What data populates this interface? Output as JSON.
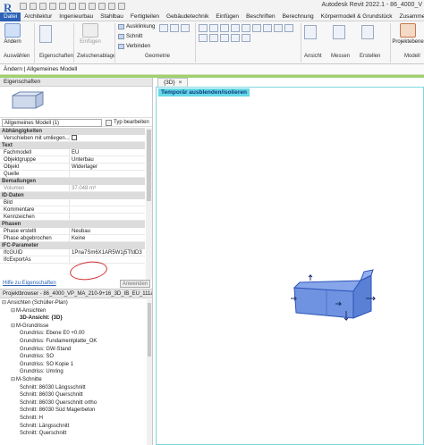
{
  "app": {
    "logo_letter": "R",
    "title": "Autodesk Revit 2022.1 - 86_4000_V"
  },
  "tabs": [
    {
      "label": "Datei",
      "active": true
    },
    {
      "label": "Architektur"
    },
    {
      "label": "Ingenieurbau"
    },
    {
      "label": "Stahlbau"
    },
    {
      "label": "Fertigteilen"
    },
    {
      "label": "Gebäudetechnik"
    },
    {
      "label": "Einfügen"
    },
    {
      "label": "Beschriften"
    },
    {
      "label": "Berechnung"
    },
    {
      "label": "Körpermodell & Grundstück"
    },
    {
      "label": "Zusammenarbe"
    }
  ],
  "ribbon": {
    "modify_label": "Ändern",
    "clipboard": {
      "paste": "Einfügen"
    },
    "geometry": {
      "cut_fill": "Ausklinkung",
      "cut": "Schnitt",
      "join": "Verbinden"
    },
    "groups": {
      "select": "Auswählen",
      "properties": "Eigenschaften",
      "clipboard": "Zwischenablage",
      "geometry": "Geometrie",
      "view": "Ansicht",
      "measure": "Messen",
      "create": "Erstellen",
      "model": "Modell"
    },
    "project_model": "Projektebene",
    "model_label": "Modell"
  },
  "context_bar": {
    "label": "Ändern | Allgemeines Modell"
  },
  "properties": {
    "header": "Eigenschaften",
    "instance_selector": "Allgemeines Modell (1)",
    "edit_type": "Typ bearbeiten",
    "sections": [
      {
        "name": "Abhängigkeiten",
        "rows": [
          {
            "key": "Verschieben mit umliegen...",
            "value": "",
            "checkbox": true
          }
        ]
      },
      {
        "name": "Text",
        "rows": [
          {
            "key": "Fachmodell",
            "value": "EU"
          },
          {
            "key": "Objektgruppe",
            "value": "Unterbau"
          },
          {
            "key": "Objekt",
            "value": "Widerlager"
          },
          {
            "key": "Quelle",
            "value": ""
          }
        ]
      },
      {
        "name": "Bemaßungen",
        "rows": [
          {
            "key": "Volumen",
            "value": "37.048 m³",
            "dim": true
          }
        ]
      },
      {
        "name": "ID-Daten",
        "rows": [
          {
            "key": "Bild",
            "value": ""
          },
          {
            "key": "Kommentare",
            "value": ""
          },
          {
            "key": "Kennzeichen",
            "value": ""
          }
        ]
      },
      {
        "name": "Phasen",
        "rows": [
          {
            "key": "Phase erstellt",
            "value": "Neubau"
          },
          {
            "key": "Phase abgebrochen",
            "value": "Keine"
          }
        ]
      },
      {
        "name": "IFC-Parameter",
        "rows": [
          {
            "key": "IfcGUID",
            "value": "1Pna7Sm6X1AR5W1j5TfdD3"
          },
          {
            "key": "IfcExportAs",
            "value": ""
          }
        ]
      }
    ],
    "help_link": "Hilfe zu Eigenschaften",
    "apply": "Anwenden"
  },
  "browser": {
    "header": "Projektbrowser - 86_4000_VP_MA_210-9+16_3D_IB_EU_111a...",
    "items": [
      {
        "label": "Ansichten (Schüller-Plan)",
        "level": 0,
        "toggle": "⊟"
      },
      {
        "label": "M-Ansichten",
        "level": 1,
        "toggle": "⊟"
      },
      {
        "label": "3D-Ansicht: {3D}",
        "level": 2,
        "selected": true
      },
      {
        "label": "M-Grundrisse",
        "level": 1,
        "toggle": "⊟"
      },
      {
        "label": "Grundriss: Ebene E0 +0.00",
        "level": 2
      },
      {
        "label": "Grundriss: Fundamentplatte_OK",
        "level": 2
      },
      {
        "label": "Grundriss: GW-Stand",
        "level": 2
      },
      {
        "label": "Grundriss: SO",
        "level": 2
      },
      {
        "label": "Grundriss: SO Kopie 1",
        "level": 2
      },
      {
        "label": "Grundriss: Umring",
        "level": 2
      },
      {
        "label": "M-Schnitte",
        "level": 1,
        "toggle": "⊟"
      },
      {
        "label": "Schnitt: 86030 Längsschnitt",
        "level": 2
      },
      {
        "label": "Schnitt: 86030 Querschnitt",
        "level": 2
      },
      {
        "label": "Schnitt: 86030 Querschnitt ortho",
        "level": 2
      },
      {
        "label": "Schnitt: 86030 Süd Magerbeton",
        "level": 2
      },
      {
        "label": "Schnitt: H",
        "level": 2
      },
      {
        "label": "Schnitt: Längsschnitt",
        "level": 2
      },
      {
        "label": "Schnitt: Querschnitt",
        "level": 2
      }
    ]
  },
  "view": {
    "tab_label": "{3D}",
    "tab_close": "×",
    "isolate_banner": "Temporär ausblenden/isolieren",
    "model_color": "#6b8fdc"
  }
}
